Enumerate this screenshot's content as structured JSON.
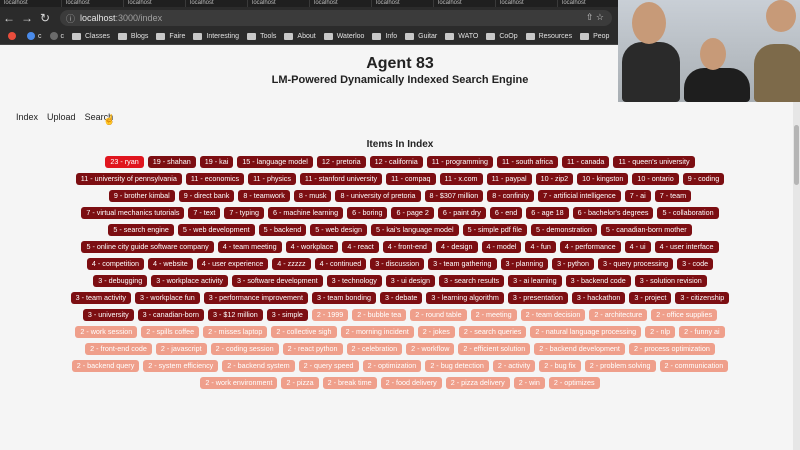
{
  "browser": {
    "tabs": [
      "localhost",
      "localhost",
      "localhost",
      "localhost",
      "localhost",
      "localhost",
      "localhost",
      "localhost",
      "localhost",
      "localhost"
    ],
    "url_host": "localhost",
    "url_path": ":3000/index",
    "bookmarks": [
      "Classes",
      "Blogs",
      "Faire",
      "Interesting",
      "Tools",
      "About",
      "Waterloo",
      "Info",
      "Guitar",
      "WATO",
      "CoOp",
      "Resources",
      "Peop"
    ],
    "bookmark_prefix": [
      "c",
      "c"
    ]
  },
  "header": {
    "title": "Agent 83",
    "subtitle": "LM-Powered Dynamically Indexed Search Engine"
  },
  "nav": {
    "index": "Index",
    "upload": "Upload",
    "search": "Search"
  },
  "index": {
    "title": "Items In Index",
    "tags": [
      {
        "label": "23 - ryan",
        "level": "top"
      },
      {
        "label": "19 - shahan",
        "level": "high"
      },
      {
        "label": "19 - kai",
        "level": "high"
      },
      {
        "label": "15 - language model",
        "level": "high"
      },
      {
        "label": "12 - pretoria",
        "level": "high"
      },
      {
        "label": "12 - california",
        "level": "high"
      },
      {
        "label": "11 - programming",
        "level": "high"
      },
      {
        "label": "11 - south africa",
        "level": "high"
      },
      {
        "label": "11 - canada",
        "level": "high"
      },
      {
        "label": "11 - queen's university",
        "level": "high"
      },
      {
        "label": "11 - university of pennsylvania",
        "level": "high"
      },
      {
        "label": "11 - economics",
        "level": "high"
      },
      {
        "label": "11 - physics",
        "level": "high"
      },
      {
        "label": "11 - stanford university",
        "level": "high"
      },
      {
        "label": "11 - compaq",
        "level": "high"
      },
      {
        "label": "11 - x.com",
        "level": "high"
      },
      {
        "label": "11 - paypal",
        "level": "high"
      },
      {
        "label": "10 - zip2",
        "level": "high"
      },
      {
        "label": "10 - kingston",
        "level": "high"
      },
      {
        "label": "10 - ontario",
        "level": "high"
      },
      {
        "label": "9 - coding",
        "level": "high"
      },
      {
        "label": "9 - brother kimbal",
        "level": "high"
      },
      {
        "label": "9 - direct bank",
        "level": "high"
      },
      {
        "label": "8 - teamwork",
        "level": "high"
      },
      {
        "label": "8 - musk",
        "level": "high"
      },
      {
        "label": "8 - university of pretoria",
        "level": "high"
      },
      {
        "label": "8 - $307 million",
        "level": "high"
      },
      {
        "label": "8 - confinity",
        "level": "high"
      },
      {
        "label": "7 - artificial intelligence",
        "level": "high"
      },
      {
        "label": "7 - ai",
        "level": "high"
      },
      {
        "label": "7 - team",
        "level": "high"
      },
      {
        "label": "7 - virtual mechanics tutorials",
        "level": "high"
      },
      {
        "label": "7 - text",
        "level": "high"
      },
      {
        "label": "7 - typing",
        "level": "high"
      },
      {
        "label": "6 - machine learning",
        "level": "high"
      },
      {
        "label": "6 - boring",
        "level": "high"
      },
      {
        "label": "6 - page 2",
        "level": "high"
      },
      {
        "label": "6 - paint dry",
        "level": "high"
      },
      {
        "label": "6 - end",
        "level": "high"
      },
      {
        "label": "6 - age 18",
        "level": "high"
      },
      {
        "label": "6 - bachelor's degrees",
        "level": "high"
      },
      {
        "label": "5 - collaboration",
        "level": "high"
      },
      {
        "label": "5 - search engine",
        "level": "high"
      },
      {
        "label": "5 - web development",
        "level": "high"
      },
      {
        "label": "5 - backend",
        "level": "high"
      },
      {
        "label": "5 - web design",
        "level": "high"
      },
      {
        "label": "5 - kai's language model",
        "level": "high"
      },
      {
        "label": "5 - simple pdf file",
        "level": "high"
      },
      {
        "label": "5 - demonstration",
        "level": "high"
      },
      {
        "label": "5 - canadian-born mother",
        "level": "high"
      },
      {
        "label": "5 - online city guide software company",
        "level": "high"
      },
      {
        "label": "4 - team meeting",
        "level": "high"
      },
      {
        "label": "4 - workplace",
        "level": "high"
      },
      {
        "label": "4 - react",
        "level": "high"
      },
      {
        "label": "4 - front-end",
        "level": "high"
      },
      {
        "label": "4 - design",
        "level": "high"
      },
      {
        "label": "4 - model",
        "level": "high"
      },
      {
        "label": "4 - fun",
        "level": "high"
      },
      {
        "label": "4 - performance",
        "level": "high"
      },
      {
        "label": "4 - ui",
        "level": "high"
      },
      {
        "label": "4 - user interface",
        "level": "high"
      },
      {
        "label": "4 - competition",
        "level": "high"
      },
      {
        "label": "4 - website",
        "level": "high"
      },
      {
        "label": "4 - user experience",
        "level": "high"
      },
      {
        "label": "4 - zzzzz",
        "level": "high"
      },
      {
        "label": "4 - continued",
        "level": "high"
      },
      {
        "label": "3 - discussion",
        "level": "high"
      },
      {
        "label": "3 - team gathering",
        "level": "high"
      },
      {
        "label": "3 - planning",
        "level": "high"
      },
      {
        "label": "3 - python",
        "level": "high"
      },
      {
        "label": "3 - query processing",
        "level": "high"
      },
      {
        "label": "3 - code",
        "level": "high"
      },
      {
        "label": "3 - debugging",
        "level": "high"
      },
      {
        "label": "3 - workplace activity",
        "level": "high"
      },
      {
        "label": "3 - software development",
        "level": "high"
      },
      {
        "label": "3 - technology",
        "level": "high"
      },
      {
        "label": "3 - ui design",
        "level": "high"
      },
      {
        "label": "3 - search results",
        "level": "high"
      },
      {
        "label": "3 - ai learning",
        "level": "high"
      },
      {
        "label": "3 - backend code",
        "level": "high"
      },
      {
        "label": "3 - solution revision",
        "level": "high"
      },
      {
        "label": "3 - team activity",
        "level": "high"
      },
      {
        "label": "3 - workplace fun",
        "level": "high"
      },
      {
        "label": "3 - performance improvement",
        "level": "high"
      },
      {
        "label": "3 - team bonding",
        "level": "high"
      },
      {
        "label": "3 - debate",
        "level": "high"
      },
      {
        "label": "3 - learning algorithm",
        "level": "high"
      },
      {
        "label": "3 - presentation",
        "level": "high"
      },
      {
        "label": "3 - hackathon",
        "level": "high"
      },
      {
        "label": "3 - project",
        "level": "high"
      },
      {
        "label": "3 - citizenship",
        "level": "high"
      },
      {
        "label": "3 - university",
        "level": "high"
      },
      {
        "label": "3 - canadian-born",
        "level": "high"
      },
      {
        "label": "3 - $12 million",
        "level": "high"
      },
      {
        "label": "3 - simple",
        "level": "high"
      },
      {
        "label": "2 - 1999",
        "level": "low"
      },
      {
        "label": "2 - bubble tea",
        "level": "low"
      },
      {
        "label": "2 - round table",
        "level": "low"
      },
      {
        "label": "2 - meeting",
        "level": "low"
      },
      {
        "label": "2 - team decision",
        "level": "low"
      },
      {
        "label": "2 - architecture",
        "level": "low"
      },
      {
        "label": "2 - office supplies",
        "level": "low"
      },
      {
        "label": "2 - work session",
        "level": "low"
      },
      {
        "label": "2 - spills coffee",
        "level": "low"
      },
      {
        "label": "2 - misses laptop",
        "level": "low"
      },
      {
        "label": "2 - collective sigh",
        "level": "low"
      },
      {
        "label": "2 - morning incident",
        "level": "low"
      },
      {
        "label": "2 - jokes",
        "level": "low"
      },
      {
        "label": "2 - search queries",
        "level": "low"
      },
      {
        "label": "2 - natural language processing",
        "level": "low"
      },
      {
        "label": "2 - nlp",
        "level": "low"
      },
      {
        "label": "2 - funny ai",
        "level": "low"
      },
      {
        "label": "2 - front-end code",
        "level": "low"
      },
      {
        "label": "2 - javascript",
        "level": "low"
      },
      {
        "label": "2 - coding session",
        "level": "low"
      },
      {
        "label": "2 - react python",
        "level": "low"
      },
      {
        "label": "2 - celebration",
        "level": "low"
      },
      {
        "label": "2 - workflow",
        "level": "low"
      },
      {
        "label": "2 - efficient solution",
        "level": "low"
      },
      {
        "label": "2 - backend development",
        "level": "low"
      },
      {
        "label": "2 - process optimization",
        "level": "low"
      },
      {
        "label": "2 - backend query",
        "level": "low"
      },
      {
        "label": "2 - system efficiency",
        "level": "low"
      },
      {
        "label": "2 - backend system",
        "level": "low"
      },
      {
        "label": "2 - query speed",
        "level": "low"
      },
      {
        "label": "2 - optimization",
        "level": "low"
      },
      {
        "label": "2 - bug detection",
        "level": "low"
      },
      {
        "label": "2 - activity",
        "level": "low"
      },
      {
        "label": "2 - bug fix",
        "level": "low"
      },
      {
        "label": "2 - problem solving",
        "level": "low"
      },
      {
        "label": "2 - communication",
        "level": "low"
      },
      {
        "label": "2 - work environment",
        "level": "low"
      },
      {
        "label": "2 - pizza",
        "level": "low"
      },
      {
        "label": "2 - break time",
        "level": "low"
      },
      {
        "label": "2 - food delivery",
        "level": "low"
      },
      {
        "label": "2 - pizza delivery",
        "level": "low"
      },
      {
        "label": "2 - win",
        "level": "low"
      },
      {
        "label": "2 - optimizes",
        "level": "low"
      }
    ]
  },
  "colors": {
    "top": "#e0151e",
    "high": "#7c0e12",
    "low": "#ef9f8b"
  },
  "icons": [
    "back-arrow-icon",
    "forward-arrow-icon",
    "reload-icon",
    "info-icon",
    "folder-icon"
  ]
}
